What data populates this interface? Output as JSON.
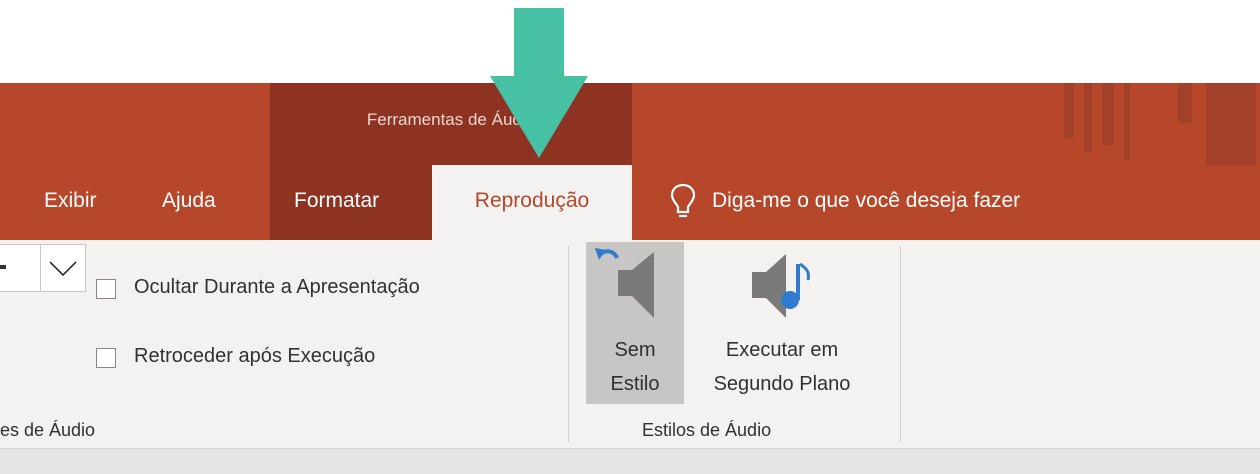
{
  "title_bar": {
    "context_group_label": "Ferramentas de Áudio"
  },
  "tabs": [
    {
      "id": "exibir",
      "label": "Exibir"
    },
    {
      "id": "ajuda",
      "label": "Ajuda"
    },
    {
      "id": "formatar",
      "label": "Formatar"
    },
    {
      "id": "reproducao",
      "label": "Reprodução",
      "active": true
    }
  ],
  "tell_me": {
    "icon": "lightbulb-icon",
    "label": "Diga-me o que você deseja fazer"
  },
  "ribbon": {
    "audio_options_group": {
      "label": "es de Áudio",
      "checkboxes": [
        {
          "label": "Ocultar Durante a Apresentação",
          "checked": false
        },
        {
          "label": "Retroceder após Execução",
          "checked": false
        }
      ]
    },
    "audio_styles_group": {
      "label": "Estilos de Áudio",
      "buttons": [
        {
          "icon": "no-style-audio-icon",
          "line1": "Sem",
          "line2": "Estilo",
          "selected": true
        },
        {
          "icon": "play-in-background-icon",
          "line1": "Executar em",
          "line2": "Segundo Plano",
          "selected": false
        }
      ]
    }
  },
  "colors": {
    "ribbon_accent": "#b7472a",
    "context_group": "#8e3321",
    "ribbon_body": "#f3f2f1",
    "annotation_arrow": "#46c1a3",
    "icon_blue": "#2e7bcf"
  }
}
